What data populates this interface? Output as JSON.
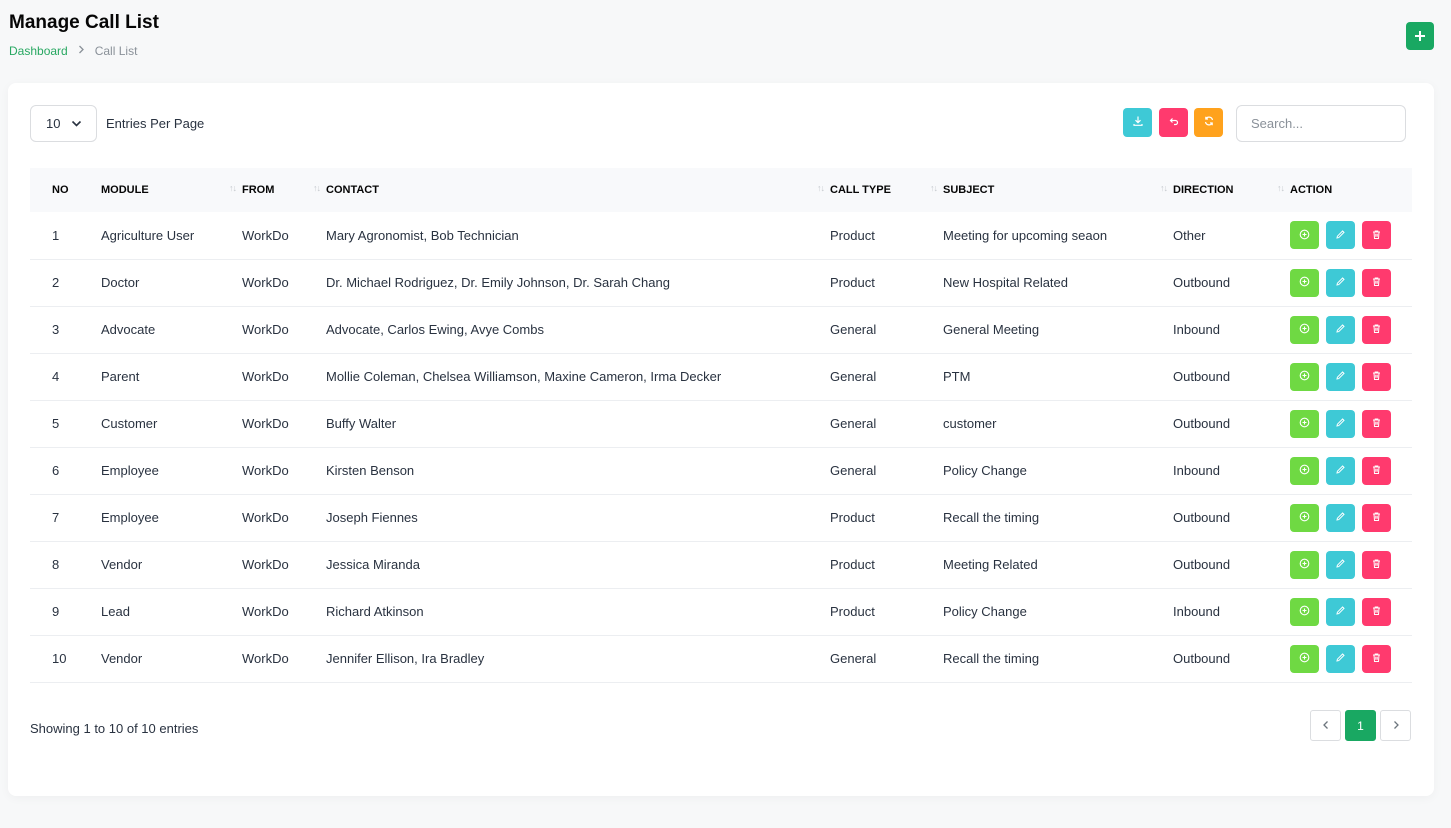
{
  "page": {
    "title": "Manage Call List",
    "breadcrumb": {
      "home": "Dashboard",
      "current": "Call List"
    },
    "add_icon": "plus-icon"
  },
  "toolbar": {
    "entries_value": "10",
    "entries_label": "Entries Per Page",
    "search_placeholder": "Search...",
    "buttons": [
      {
        "name": "export",
        "icon": "download-icon",
        "color": "#3ec9d6"
      },
      {
        "name": "reset",
        "icon": "undo-icon",
        "color": "#ff3a6e"
      },
      {
        "name": "reload",
        "icon": "refresh-icon",
        "color": "#ffa21d"
      }
    ]
  },
  "colors": {
    "brand": "#19a862",
    "view": "#6fd943",
    "edit": "#3ec9d6",
    "delete": "#ff3a6e"
  },
  "table": {
    "columns": [
      "NO",
      "MODULE",
      "FROM",
      "CONTACT",
      "CALL TYPE",
      "SUBJECT",
      "DIRECTION",
      "ACTION"
    ],
    "rows": [
      {
        "no": "1",
        "module": "Agriculture User",
        "from": "WorkDo",
        "contact": "Mary Agronomist, Bob Technician",
        "call_type": "Product",
        "subject": "Meeting for upcoming seaon",
        "direction": "Other"
      },
      {
        "no": "2",
        "module": "Doctor",
        "from": "WorkDo",
        "contact": "Dr. Michael Rodriguez, Dr. Emily Johnson, Dr. Sarah Chang",
        "call_type": "Product",
        "subject": "New Hospital Related",
        "direction": "Outbound"
      },
      {
        "no": "3",
        "module": "Advocate",
        "from": "WorkDo",
        "contact": "Advocate, Carlos Ewing, Avye Combs",
        "call_type": "General",
        "subject": "General Meeting",
        "direction": "Inbound"
      },
      {
        "no": "4",
        "module": "Parent",
        "from": "WorkDo",
        "contact": "Mollie Coleman, Chelsea Williamson, Maxine Cameron, Irma Decker",
        "call_type": "General",
        "subject": "PTM",
        "direction": "Outbound"
      },
      {
        "no": "5",
        "module": "Customer",
        "from": "WorkDo",
        "contact": "Buffy Walter",
        "call_type": "General",
        "subject": "customer",
        "direction": "Outbound"
      },
      {
        "no": "6",
        "module": "Employee",
        "from": "WorkDo",
        "contact": "Kirsten Benson",
        "call_type": "General",
        "subject": "Policy Change",
        "direction": "Inbound"
      },
      {
        "no": "7",
        "module": "Employee",
        "from": "WorkDo",
        "contact": "Joseph Fiennes",
        "call_type": "Product",
        "subject": "Recall the timing",
        "direction": "Outbound"
      },
      {
        "no": "8",
        "module": "Vendor",
        "from": "WorkDo",
        "contact": "Jessica Miranda",
        "call_type": "Product",
        "subject": "Meeting Related",
        "direction": "Outbound"
      },
      {
        "no": "9",
        "module": "Lead",
        "from": "WorkDo",
        "contact": "Richard Atkinson",
        "call_type": "Product",
        "subject": "Policy Change",
        "direction": "Inbound"
      },
      {
        "no": "10",
        "module": "Vendor",
        "from": "WorkDo",
        "contact": "Jennifer Ellison, Ira Bradley",
        "call_type": "General",
        "subject": "Recall the timing",
        "direction": "Outbound"
      }
    ]
  },
  "footer": {
    "showing": "Showing 1 to 10 of 10 entries",
    "prev_icon": "chevron-left-icon",
    "current_page": "1",
    "next_icon": "chevron-right-icon"
  }
}
